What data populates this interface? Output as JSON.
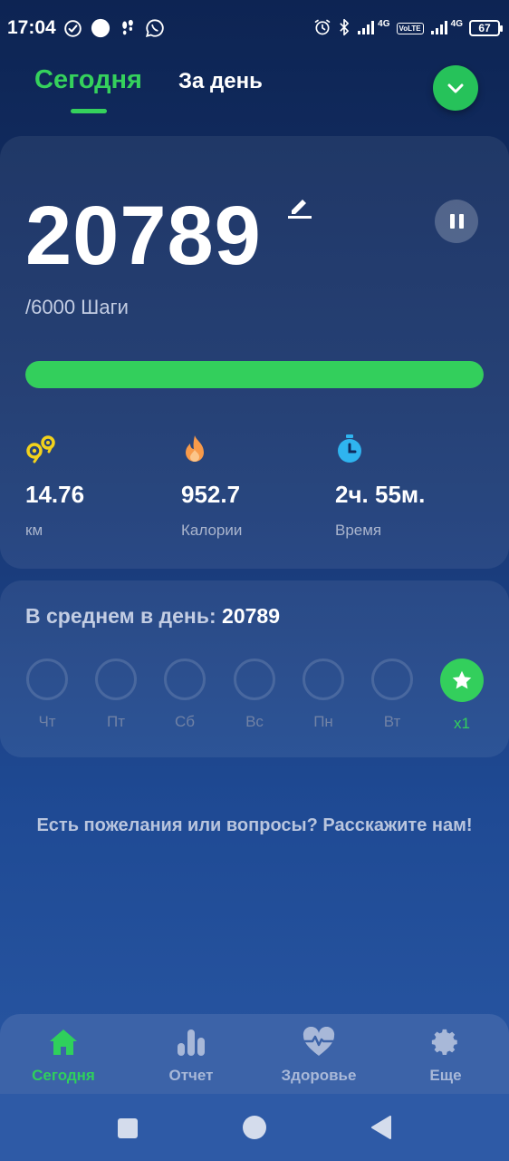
{
  "status_bar": {
    "time": "17:04",
    "network_labels": [
      "4G",
      "VoLTE",
      "4G"
    ],
    "battery": "67"
  },
  "top_tabs": {
    "today": "Сегодня",
    "day": "За день"
  },
  "steps": {
    "count": "20789",
    "goal": "/6000 Шаги",
    "progress": 1.0
  },
  "stats": [
    {
      "icon": "distance-icon",
      "value": "14.76",
      "label": "км"
    },
    {
      "icon": "flame-icon",
      "value": "952.7",
      "label": "Калории"
    },
    {
      "icon": "stopwatch-icon",
      "value": "2ч. 55м.",
      "label": "Время"
    }
  ],
  "average": {
    "label": "В среднем в день:",
    "value": "20789",
    "days": [
      {
        "label": "Чт",
        "done": false
      },
      {
        "label": "Пт",
        "done": false
      },
      {
        "label": "Сб",
        "done": false
      },
      {
        "label": "Вс",
        "done": false
      },
      {
        "label": "Пн",
        "done": false
      },
      {
        "label": "Вт",
        "done": false
      },
      {
        "label": "x1",
        "done": true
      }
    ]
  },
  "feedback": "Есть пожелания или вопросы? Расскажите нам!",
  "bottom_nav": [
    {
      "label": "Сегодня",
      "icon": "home-icon",
      "active": true
    },
    {
      "label": "Отчет",
      "icon": "bar-chart-icon",
      "active": false
    },
    {
      "label": "Здоровье",
      "icon": "heart-pulse-icon",
      "active": false
    },
    {
      "label": "Еще",
      "icon": "gear-icon",
      "active": false
    }
  ],
  "colors": {
    "accent": "#33cf5c",
    "background": "#16336c"
  }
}
